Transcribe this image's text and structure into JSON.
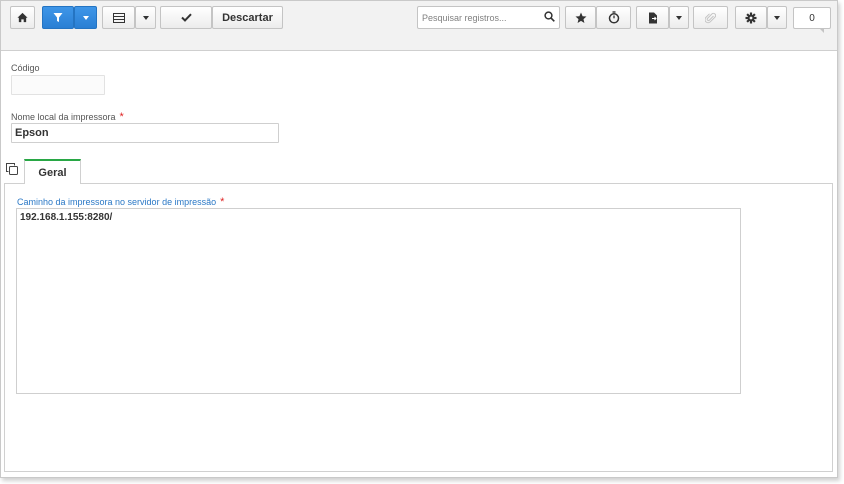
{
  "toolbar": {
    "discard_label": "Descartar",
    "search_placeholder": "Pesquisar registros...",
    "record_count": "0"
  },
  "form": {
    "code_label": "Código",
    "code_value": "",
    "printer_name_label": "Nome local da impressora",
    "printer_name_value": "Epson",
    "required_mark": "*"
  },
  "tabs": [
    {
      "label": "Geral",
      "active": true
    }
  ],
  "general": {
    "path_label": "Caminho da impressora no servidor de impressão",
    "path_value": "192.168.1.155:8280/"
  },
  "colors": {
    "primary_blue": "#2a7fd4",
    "required_red": "#e02424",
    "active_tab_green": "#28a745",
    "label_blue": "#2a78c6"
  }
}
